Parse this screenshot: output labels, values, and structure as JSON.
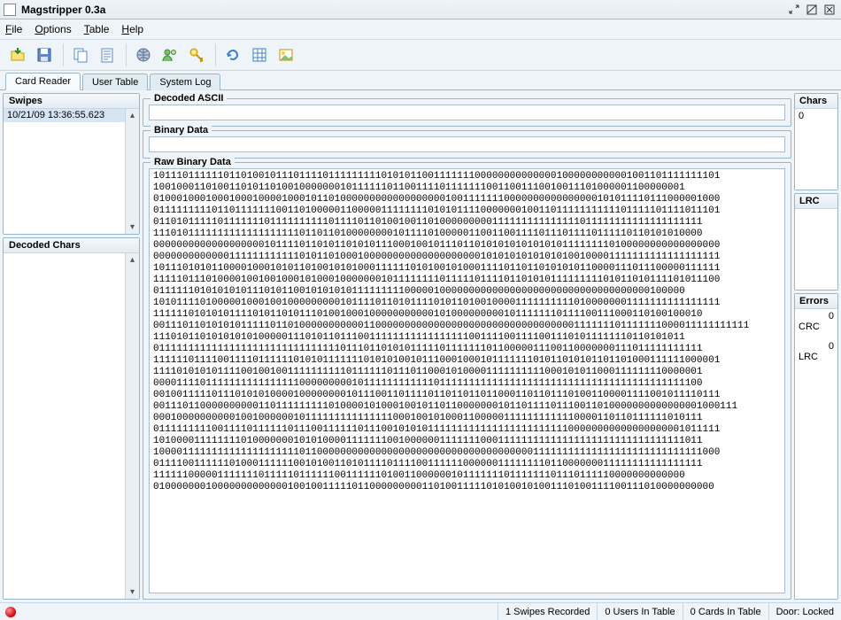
{
  "window": {
    "title": "Magstripper 0.3a"
  },
  "menu": {
    "file": "File",
    "options": "Options",
    "table": "Table",
    "help": "Help"
  },
  "tabs": {
    "card_reader": "Card Reader",
    "user_table": "User Table",
    "system_log": "System Log"
  },
  "swipes": {
    "title": "Swipes",
    "items": [
      "10/21/09 13:36:55.623"
    ]
  },
  "decoded_chars": {
    "title": "Decoded Chars"
  },
  "decoded_ascii": {
    "title": "Decoded ASCII",
    "value": ""
  },
  "binary_data": {
    "title": "Binary Data",
    "value": ""
  },
  "raw_binary": {
    "title": "Raw Binary Data",
    "value": "1011101111110110100101110111101111111110101011001111111000000000000001000000000001001101111111101\n1001000110100110101101001000000010111111011001111011111110011001110010011101000001100000001\n0100010001000100010000100010110100000000000000000010011111110000000000000000101011110111000001000\n0111111111011011111110011010000011000001111111101010111100000001001101111111111101111101111011101\n0110101111101111111011111111110111101101001001101000000000111111111111111011111111111111111111\n1110101111111111111111111011011010000000010111101000001100110011110111011110111110110101010000\n0000000000000000000101111011010110101011100010010111011010101010101010111111110100000000000000000\n0000000000000111111111111010110100010000000000000000000010101010101010100100001111111111111111111\n1011101010110000100010101101001010100011111101010010100011110110110101010110000111011100000111111\n1111101110100001001001000101000100000001011111111011111011110110101011111111101011010111101011100\n0111111010101010111010110010101010111111111000001000000000000000000000000000000000000100000\n1010111101000001000100100000000010111101101011110101101001000011111111110100000001111111111111111\n1111110101010111101011010111010010001000000000001010000000001011111110111100111000110100100010\n001110110101010111110110100000000000110000000000000000000000000000000000111111101111111000011111111111\n1110101101010101010000011101011011100111111111111111110011110011110011101011111110110101011\n0111111111111111111111111111111101110110101011111011111110110000011100110000000111011111111111\n1111110111100111101111110101011111110101010010111000100010111111101011010101101101000111111000001\n1111010101011110010010011111111110111111011101100010100001111111111000101011000111111110000001\n0000111101111111111111111000000000101111111111110111111111111111111111111111111111111111111100\n0010011111011101010100001000000001011100110111101101101101100011011011101001100001111001011110111\n0011101100000000001101111111110100001010001001011011000000010110111101110011010000000000000001000111\n0001000000000010010000001011111111111111100010010100011000001111111111110000110110111111010111\n0111111111001111011111101110011111101110010101011111111111111111111111100000000000000000001011111\n1010000111111110100000001010100001111111001000000111111100011111111111111111111111111111111011\n1000011111111111111111111011000000000000000000000000000000000000011111111111111111111111111111000\n0111100111111010001111110010100110101111011110011111100000011111111011000000011111111111111111\n1111110000011111110111110111111001111110100110000001011111110111111101110111110000000000000\n010000000100000000000001001001111101100000000011010011111010100101001110100111100111010000000000"
  },
  "chars": {
    "title": "Chars",
    "value": "0"
  },
  "lrc_panel": {
    "title": "LRC"
  },
  "errors": {
    "title": "Errors",
    "crc_label": "CRC",
    "crc_count": "0",
    "lrc_label": "LRC",
    "lrc_count": "0"
  },
  "status": {
    "swipes": "1 Swipes Recorded",
    "users": "0 Users In Table",
    "cards": "0 Cards In Table",
    "door": "Door: Locked"
  }
}
